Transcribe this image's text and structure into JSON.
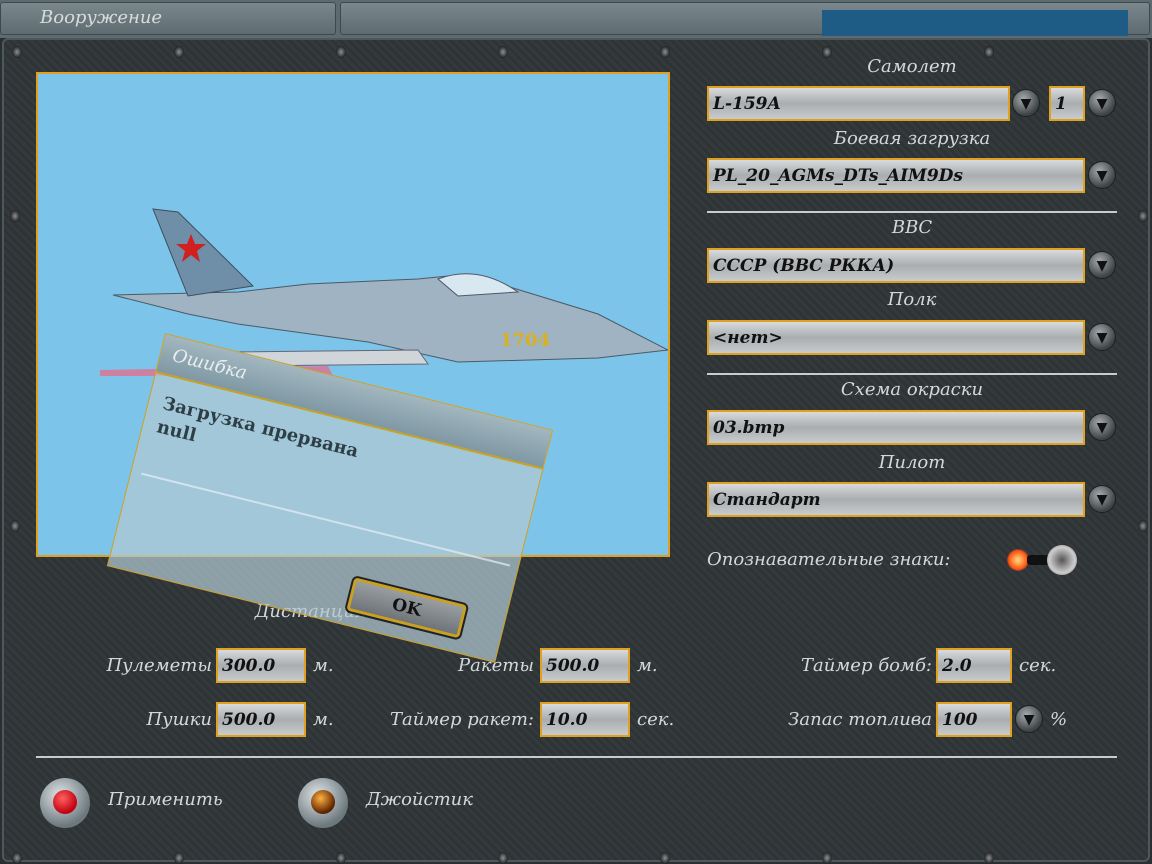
{
  "window": {
    "title": "Вооружение"
  },
  "aircraft": {
    "label": "Самолет",
    "value": "L-159A",
    "count": "1"
  },
  "loadout": {
    "label": "Боевая загрузка",
    "value": "PL_20_AGMs_DTs_AIM9Ds"
  },
  "airforce": {
    "label": "ВВС",
    "value": "СССР (ВВС РККА)"
  },
  "regiment": {
    "label": "Полк",
    "value": "<нет>"
  },
  "skin": {
    "label": "Схема окраски",
    "value": "03.bmp"
  },
  "pilot": {
    "label": "Пилот",
    "value": "Стандарт"
  },
  "markings": {
    "label": "Опознавательные знаки:",
    "enabled": true
  },
  "convergence": {
    "title": "Дистанция сведения",
    "mg": {
      "label": "Пулеметы",
      "value": "300.0",
      "unit": "м."
    },
    "cannon": {
      "label": "Пушки",
      "value": "500.0",
      "unit": "м."
    },
    "rockets": {
      "label": "Ракеты",
      "value": "500.0",
      "unit": "м."
    },
    "rocket_timer": {
      "label": "Таймер ракет:",
      "value": "10.0",
      "unit": "сек."
    },
    "bomb_timer": {
      "label": "Таймер бомб:",
      "value": "2.0",
      "unit": "сек."
    },
    "fuel": {
      "label": "Запас топлива",
      "value": "100",
      "unit": "%"
    }
  },
  "buttons": {
    "apply": "Применить",
    "joystick": "Джойстик"
  },
  "dialog": {
    "title": "Ошибка",
    "message": "Загрузка прервана\nnull",
    "ok": "OK"
  },
  "colors": {
    "accent": "#e0a020",
    "sky": "#7cc4ea"
  }
}
